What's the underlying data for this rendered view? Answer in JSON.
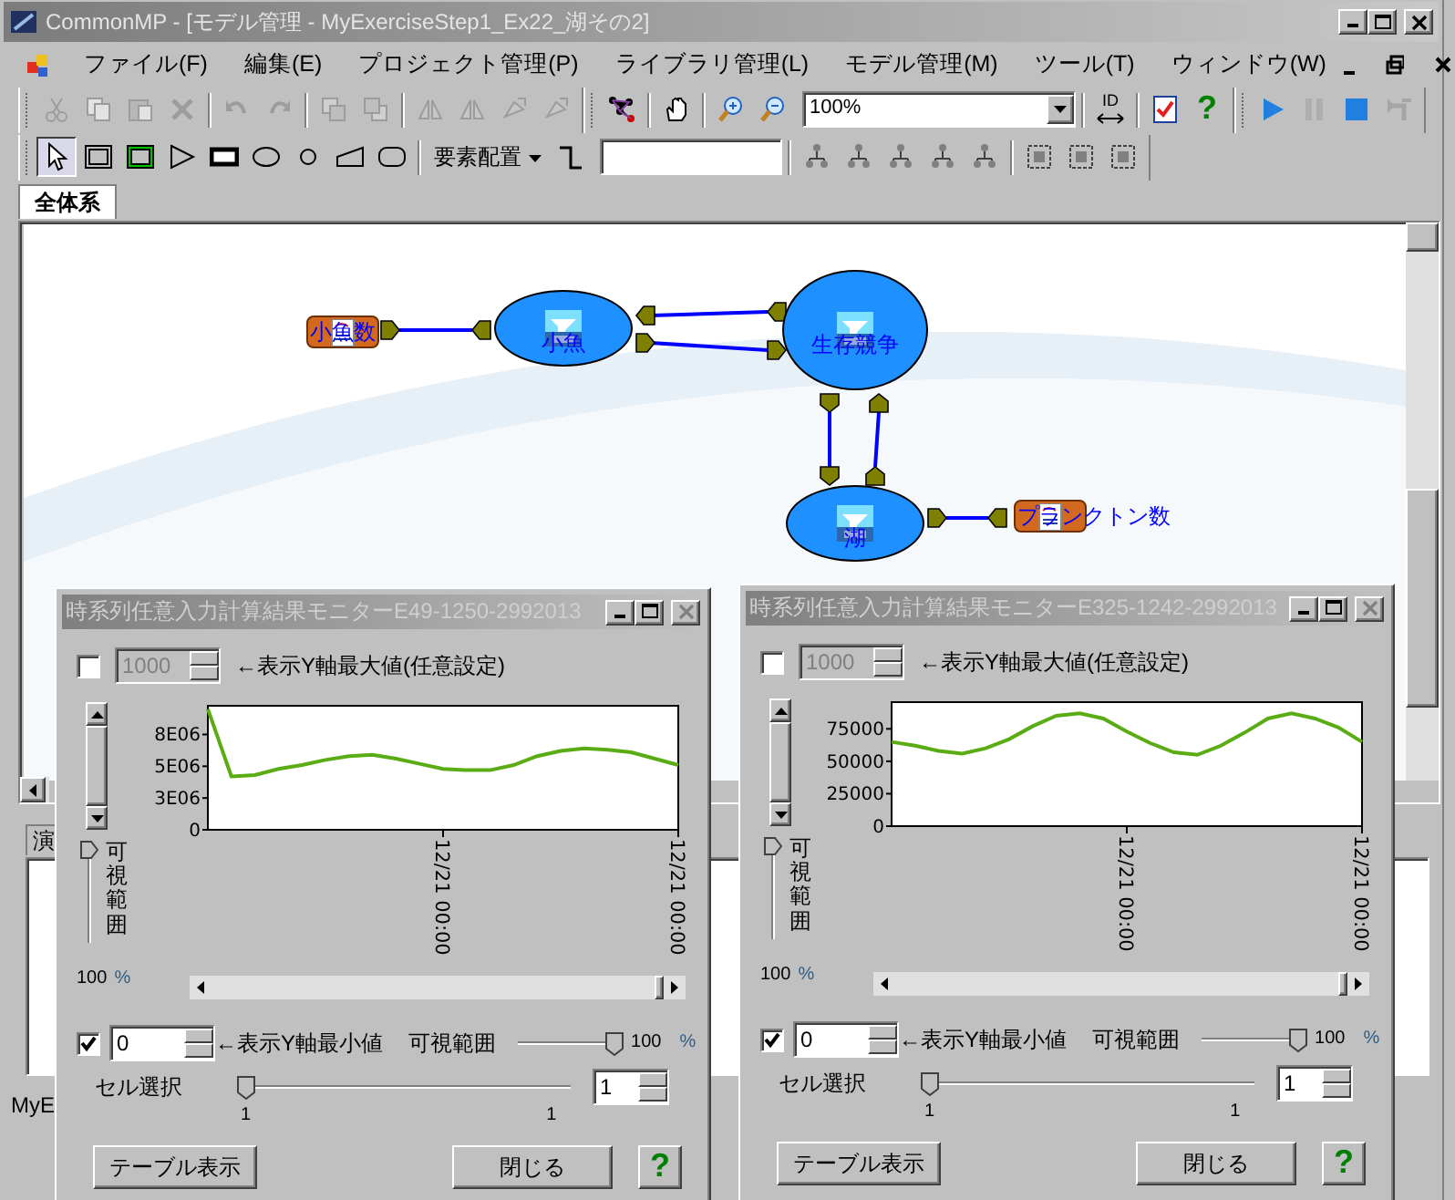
{
  "window": {
    "title": "CommonMP - [モデル管理 - MyExerciseStep1_Ex22_湖その2]"
  },
  "menu": [
    "ファイル(F)",
    "編集(E)",
    "プロジェクト管理(P)",
    "ライブラリ管理(L)",
    "モデル管理(M)",
    "ツール(T)",
    "ウィンドウ(W)"
  ],
  "toolbar1": [
    [
      {
        "kind": "cut",
        "disabled": true
      },
      {
        "kind": "copy",
        "disabled": true
      },
      {
        "kind": "paste",
        "disabled": true
      },
      {
        "kind": "delete",
        "disabled": true
      }
    ],
    [
      {
        "kind": "undo",
        "disabled": true
      },
      {
        "kind": "redo",
        "disabled": true
      }
    ],
    [
      {
        "kind": "front",
        "disabled": true
      },
      {
        "kind": "back",
        "disabled": true
      }
    ],
    [
      {
        "kind": "flip",
        "disabled": true
      },
      {
        "kind": "flip",
        "disabled": true
      },
      {
        "kind": "rotate",
        "disabled": true
      },
      {
        "kind": "rotate",
        "disabled": true
      }
    ],
    [
      {
        "kind": "network",
        "disabled": false
      }
    ],
    [
      {
        "kind": "hand",
        "disabled": false
      }
    ],
    [
      {
        "kind": "zoomin",
        "disabled": false
      },
      {
        "kind": "zoomout",
        "disabled": false
      },
      {
        "kind": "combo",
        "value": "100%"
      }
    ],
    [
      {
        "kind": "id",
        "text": "ID"
      }
    ],
    [
      {
        "kind": "check",
        "disabled": false
      },
      {
        "kind": "help",
        "text": "?"
      }
    ],
    [
      {
        "kind": "play",
        "disabled": false
      },
      {
        "kind": "pause",
        "disabled": true
      },
      {
        "kind": "stop",
        "disabled": false
      },
      {
        "kind": "stepback",
        "disabled": true
      }
    ]
  ],
  "toolbar2": [
    [
      {
        "kind": "pointer",
        "selected": true
      },
      {
        "kind": "frame",
        "selected": false
      },
      {
        "kind": "greenframe",
        "selected": false
      },
      {
        "kind": "triangle",
        "selected": false
      },
      {
        "kind": "filledrect",
        "selected": false
      },
      {
        "kind": "ellipse",
        "selected": false
      },
      {
        "kind": "circle",
        "selected": false
      },
      {
        "kind": "trapezoid",
        "selected": false
      },
      {
        "kind": "roundrect",
        "selected": false
      }
    ],
    [
      {
        "kind": "dropdown",
        "text": "要素配置"
      },
      {
        "kind": "stepline"
      },
      {
        "kind": "field"
      }
    ],
    [
      {
        "kind": "layout"
      },
      {
        "kind": "layout"
      },
      {
        "kind": "layout"
      },
      {
        "kind": "layout"
      },
      {
        "kind": "layout"
      }
    ],
    [
      {
        "kind": "group"
      },
      {
        "kind": "group"
      },
      {
        "kind": "group"
      }
    ]
  ],
  "tabs": [
    {
      "label": "全体系",
      "selected": true
    }
  ],
  "diagram": {
    "nodes": [
      {
        "kind": "output",
        "label": "小魚数"
      },
      {
        "kind": "element",
        "label": "小魚"
      },
      {
        "kind": "element",
        "label": "生存競争"
      },
      {
        "kind": "element",
        "label": "湖"
      },
      {
        "kind": "output",
        "label": "プランクトン数"
      }
    ]
  },
  "bottom_panel": {
    "tab": "演",
    "status": "MyE"
  },
  "monitors": [
    {
      "title": "時系列任意入力計算結果モニターE49-1250-2992013",
      "max": {
        "checked": false,
        "value": "1000",
        "label": "←表示Y軸最大値(任意設定)"
      },
      "range_vertical": {
        "label": "可視範囲",
        "level": 1
      },
      "percent": {
        "value": "100",
        "unit": "%"
      },
      "min": {
        "checked": true,
        "value": "0",
        "label": "←表示Y軸最小値"
      },
      "range": {
        "label": "可視範囲",
        "level": 1,
        "value": "100",
        "unit": "%"
      },
      "cell": {
        "label": "セル選択",
        "level": 0,
        "min": "1",
        "max": "1",
        "value": "1"
      },
      "buttons": [
        "テーブル表示",
        "閉じる"
      ],
      "help": "?",
      "chart_data": {
        "type": "line",
        "categories": [
          null,
          null,
          null,
          null,
          null,
          null,
          null,
          null,
          null,
          null,
          "12/21 00:00",
          null,
          null,
          null,
          null,
          null,
          null,
          null,
          null,
          null,
          "12/21 00:00"
        ],
        "ylim": [
          0,
          9760000
        ],
        "yticks": [
          {
            "value": 0,
            "label": "0"
          },
          {
            "value": 2500000,
            "label": "3E06"
          },
          {
            "value": 5000000,
            "label": "5E06"
          },
          {
            "value": 7500000,
            "label": "8E06"
          }
        ],
        "series": [
          {
            "color": "#5aac14",
            "values": [
              9500000,
              4200000,
              4300000,
              4800000,
              5100000,
              5500000,
              5800000,
              5900000,
              5600000,
              5200000,
              4800000,
              4700000,
              4700000,
              5100000,
              5800000,
              6200000,
              6400000,
              6300000,
              6100000,
              5600000,
              5100000
            ]
          }
        ]
      }
    },
    {
      "title": "時系列任意入力計算結果モニターE325-1242-2992013",
      "max": {
        "checked": false,
        "value": "1000",
        "label": "←表示Y軸最大値(任意設定)"
      },
      "range_vertical": {
        "label": "可視範囲",
        "level": 1
      },
      "percent": {
        "value": "100",
        "unit": "%"
      },
      "min": {
        "checked": true,
        "value": "0",
        "label": "←表示Y軸最小値"
      },
      "range": {
        "label": "可視範囲",
        "level": 1,
        "value": "100",
        "unit": "%"
      },
      "cell": {
        "label": "セル選択",
        "level": 0,
        "min": "1",
        "max": "1",
        "value": "1"
      },
      "buttons": [
        "テーブル表示",
        "閉じる"
      ],
      "help": "?",
      "chart_data": {
        "type": "line",
        "categories": [
          null,
          null,
          null,
          null,
          null,
          null,
          null,
          null,
          null,
          null,
          "12/21 00:00",
          null,
          null,
          null,
          null,
          null,
          null,
          null,
          null,
          null,
          "12/21 00:00"
        ],
        "ylim": [
          0,
          95600
        ],
        "yticks": [
          {
            "value": 0,
            "label": "0"
          },
          {
            "value": 25000,
            "label": "25000"
          },
          {
            "value": 50000,
            "label": "50000"
          },
          {
            "value": 75000,
            "label": "75000"
          }
        ],
        "series": [
          {
            "color": "#5aac14",
            "values": [
              65000,
              62000,
              58000,
              56000,
              60000,
              67000,
              77000,
              85000,
              87000,
              83000,
              73000,
              64000,
              57000,
              55000,
              62000,
              72000,
              83000,
              87000,
              83000,
              76000,
              65000
            ]
          }
        ]
      }
    }
  ]
}
